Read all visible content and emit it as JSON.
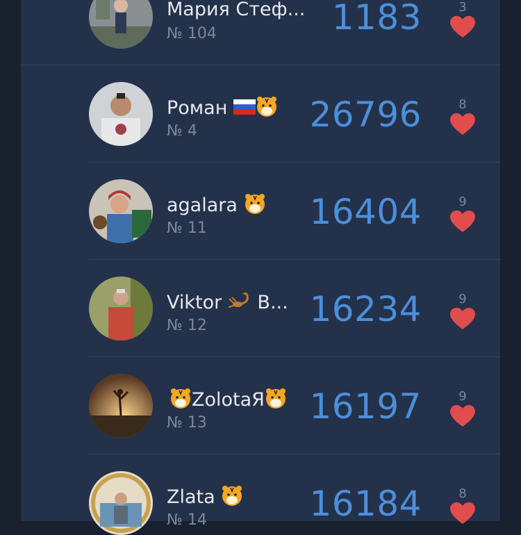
{
  "rows": [
    {
      "name": "Мария Стеф...",
      "rank": "№ 104",
      "score": "1183",
      "likes": "3"
    },
    {
      "name": "Роман",
      "rank": "№ 4",
      "score": "26796",
      "likes": "8"
    },
    {
      "name": "agalara",
      "rank": "№ 11",
      "score": "16404",
      "likes": "9"
    },
    {
      "name": "Viktor",
      "name_suffix": "B...",
      "rank": "№ 12",
      "score": "16234",
      "likes": "9"
    },
    {
      "name": "ZolotaЯ",
      "rank": "№ 13",
      "score": "16197",
      "likes": "9"
    },
    {
      "name": "Zlata",
      "rank": "№ 14",
      "score": "16184",
      "likes": "8"
    }
  ],
  "colors": {
    "score": "#4c8fdb",
    "heart": "#e14c4c",
    "panel": "#24314a",
    "background": "#19202e"
  }
}
